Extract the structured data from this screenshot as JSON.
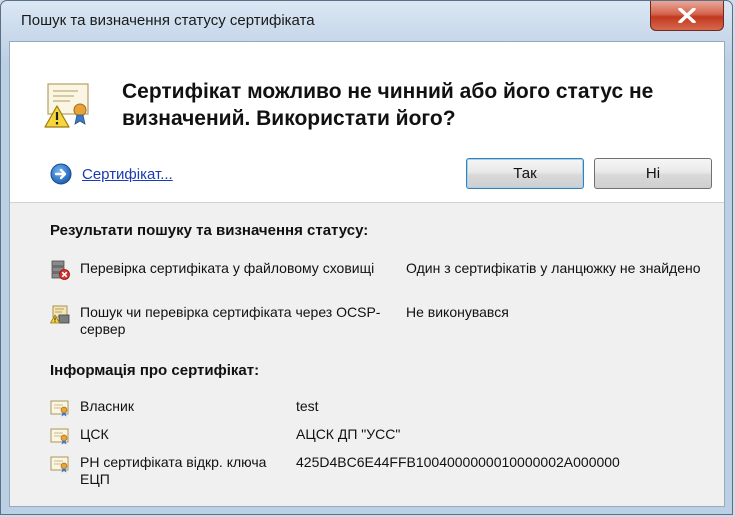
{
  "window": {
    "title": "Пошук та визначення статусу сертифіката"
  },
  "prompt": {
    "heading": "Сертифікат можливо не чинний або його статус не визначений. Використати його?",
    "cert_link": "Сертифікат...",
    "yes_label": "Так",
    "no_label": "Ні"
  },
  "results": {
    "title": "Результати пошуку та визначення статусу:",
    "items": [
      {
        "label": "Перевірка сертифіката у файловому сховищі",
        "value": "Один з сертифікатів у ланцюжку не знайдено",
        "icon": "file-store-error-icon"
      },
      {
        "label": "Пошук чи перевірка сертифіката через OCSP-сервер",
        "value": "Не виконувався",
        "icon": "ocsp-server-warning-icon"
      }
    ]
  },
  "info": {
    "title": "Інформація про сертифікат:",
    "items": [
      {
        "label": "Власник",
        "value": "test",
        "icon": "certificate-icon"
      },
      {
        "label": "ЦСК",
        "value": "АЦСК ДП \"УСС\"",
        "icon": "certificate-icon"
      },
      {
        "label": "РН сертифіката відкр. ключа ЕЦП",
        "value": "425D4BC6E44FFB1004000000010000002A000000",
        "icon": "certificate-icon"
      }
    ]
  },
  "colors": {
    "link": "#1a3cb5",
    "close_button": "#c2381f",
    "default_button_border": "#3c7fb1"
  }
}
